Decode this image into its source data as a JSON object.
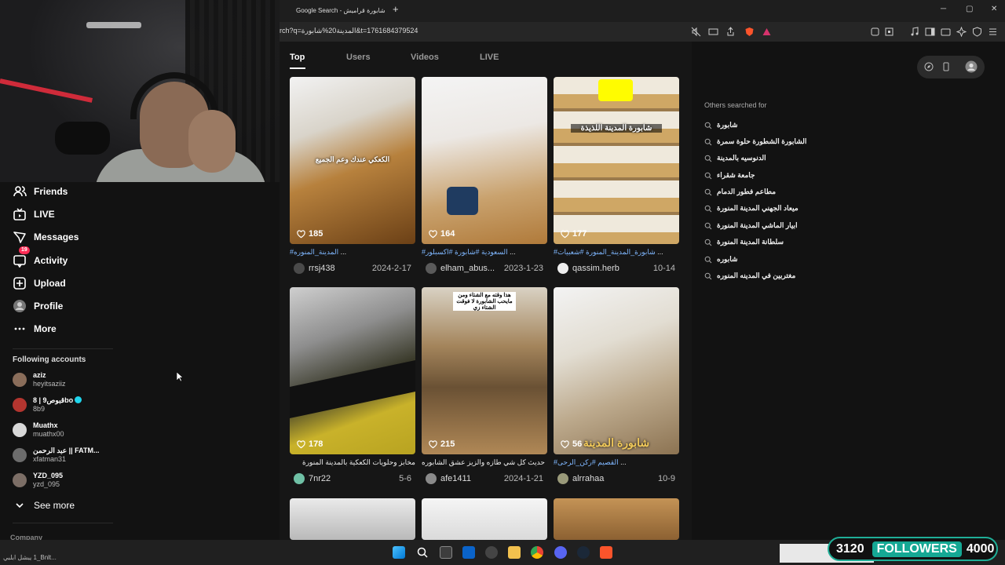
{
  "browser": {
    "tab_title": "Google Search - شابورة قراميش",
    "url": "rch?q=المدينة20%شابورة&t=1761684379524"
  },
  "sidebar": {
    "items": [
      {
        "label": "Friends",
        "icon": "friends-icon"
      },
      {
        "label": "LIVE",
        "icon": "live-icon"
      },
      {
        "label": "Messages",
        "icon": "messages-icon"
      },
      {
        "label": "Activity",
        "icon": "activity-icon",
        "badge": "19"
      },
      {
        "label": "Upload",
        "icon": "upload-icon"
      },
      {
        "label": "Profile",
        "icon": "profile-icon"
      },
      {
        "label": "More",
        "icon": "more-icon"
      }
    ],
    "following_title": "Following accounts",
    "accounts": [
      {
        "name": "aziz",
        "handle": "heyitsaziiz",
        "color": "#8a6d5a"
      },
      {
        "name": "8 | قبوص9bo",
        "handle": "8b9",
        "color": "#b3352f",
        "verified": true
      },
      {
        "name": "Muathx",
        "handle": "muathx00",
        "color": "#d8d8d8"
      },
      {
        "name": "عبد الرحمن || FATM...",
        "handle": "xfatman31",
        "color": "#6c6c6c"
      },
      {
        "name": "YZD_095",
        "handle": "yzd_095",
        "color": "#7c6e66"
      }
    ],
    "see_more": "See more",
    "company": "Company"
  },
  "search_tabs": [
    "Top",
    "Users",
    "Videos",
    "LIVE"
  ],
  "videos": [
    {
      "likes": "185",
      "overlay": "الكعكي عندك وعم الجميع",
      "caption_tag": "#المدينة_المنوره",
      "caption_rest": " ...",
      "user": "rrsj438",
      "date": "2024-2-17"
    },
    {
      "likes": "164",
      "overlay": "",
      "caption_tag": "#السعودية #شابورة #اكسبلور",
      "caption_rest": " ...",
      "user": "elham_abus...",
      "date": "2023-1-23"
    },
    {
      "likes": "177",
      "overlay": "شابورة المدينة اللذيذة",
      "caption_tag": "#شابورة_المدينة_المنورة #شعبيات",
      "caption_rest": " ...",
      "user": "qassim.herb",
      "date": "10-14"
    },
    {
      "likes": "178",
      "overlay": "",
      "caption_tag": "",
      "caption_rest": "مخابز وحلويات الكعكية بالمدينة المنورة",
      "user": "7nr22",
      "date": "5-6"
    },
    {
      "likes": "215",
      "overlay": "هذا وقته مع الشتاء ومن مايحب الشابورة لا فوقت الشتاء زي",
      "caption_tag": "",
      "caption_rest": "حديث كل شي طازه والزيز عشق الشابوره ...",
      "user": "afe1411",
      "date": "2024-1-21"
    },
    {
      "likes": "56",
      "overlay": "شابورة المدينة",
      "caption_tag": "#القصيم #ركن_الرحى",
      "caption_rest": " ...",
      "user": "alrrahaa",
      "date": "10-9"
    }
  ],
  "others": {
    "title": "Others searched for",
    "items": [
      "شابورة",
      "الشابورة الشطورة حلوة سمرة",
      "الدنوسيه بالمدينة",
      "جامعة شقراء",
      "مطاعم فطور الدمام",
      "ميعاد الجهني المدينة المنورة",
      "ابيار الماشي المدينة المنورة",
      "سلطانة المدينة المنورة",
      "شابوره",
      "مغتربين في المدينه المنوره"
    ]
  },
  "taskbar": {
    "left_text": "يبشل ابلبي‎ 1_Bnlt..."
  },
  "followers_widget": {
    "count": "3120",
    "label": "FOLLOWERS",
    "goal": "4000"
  }
}
